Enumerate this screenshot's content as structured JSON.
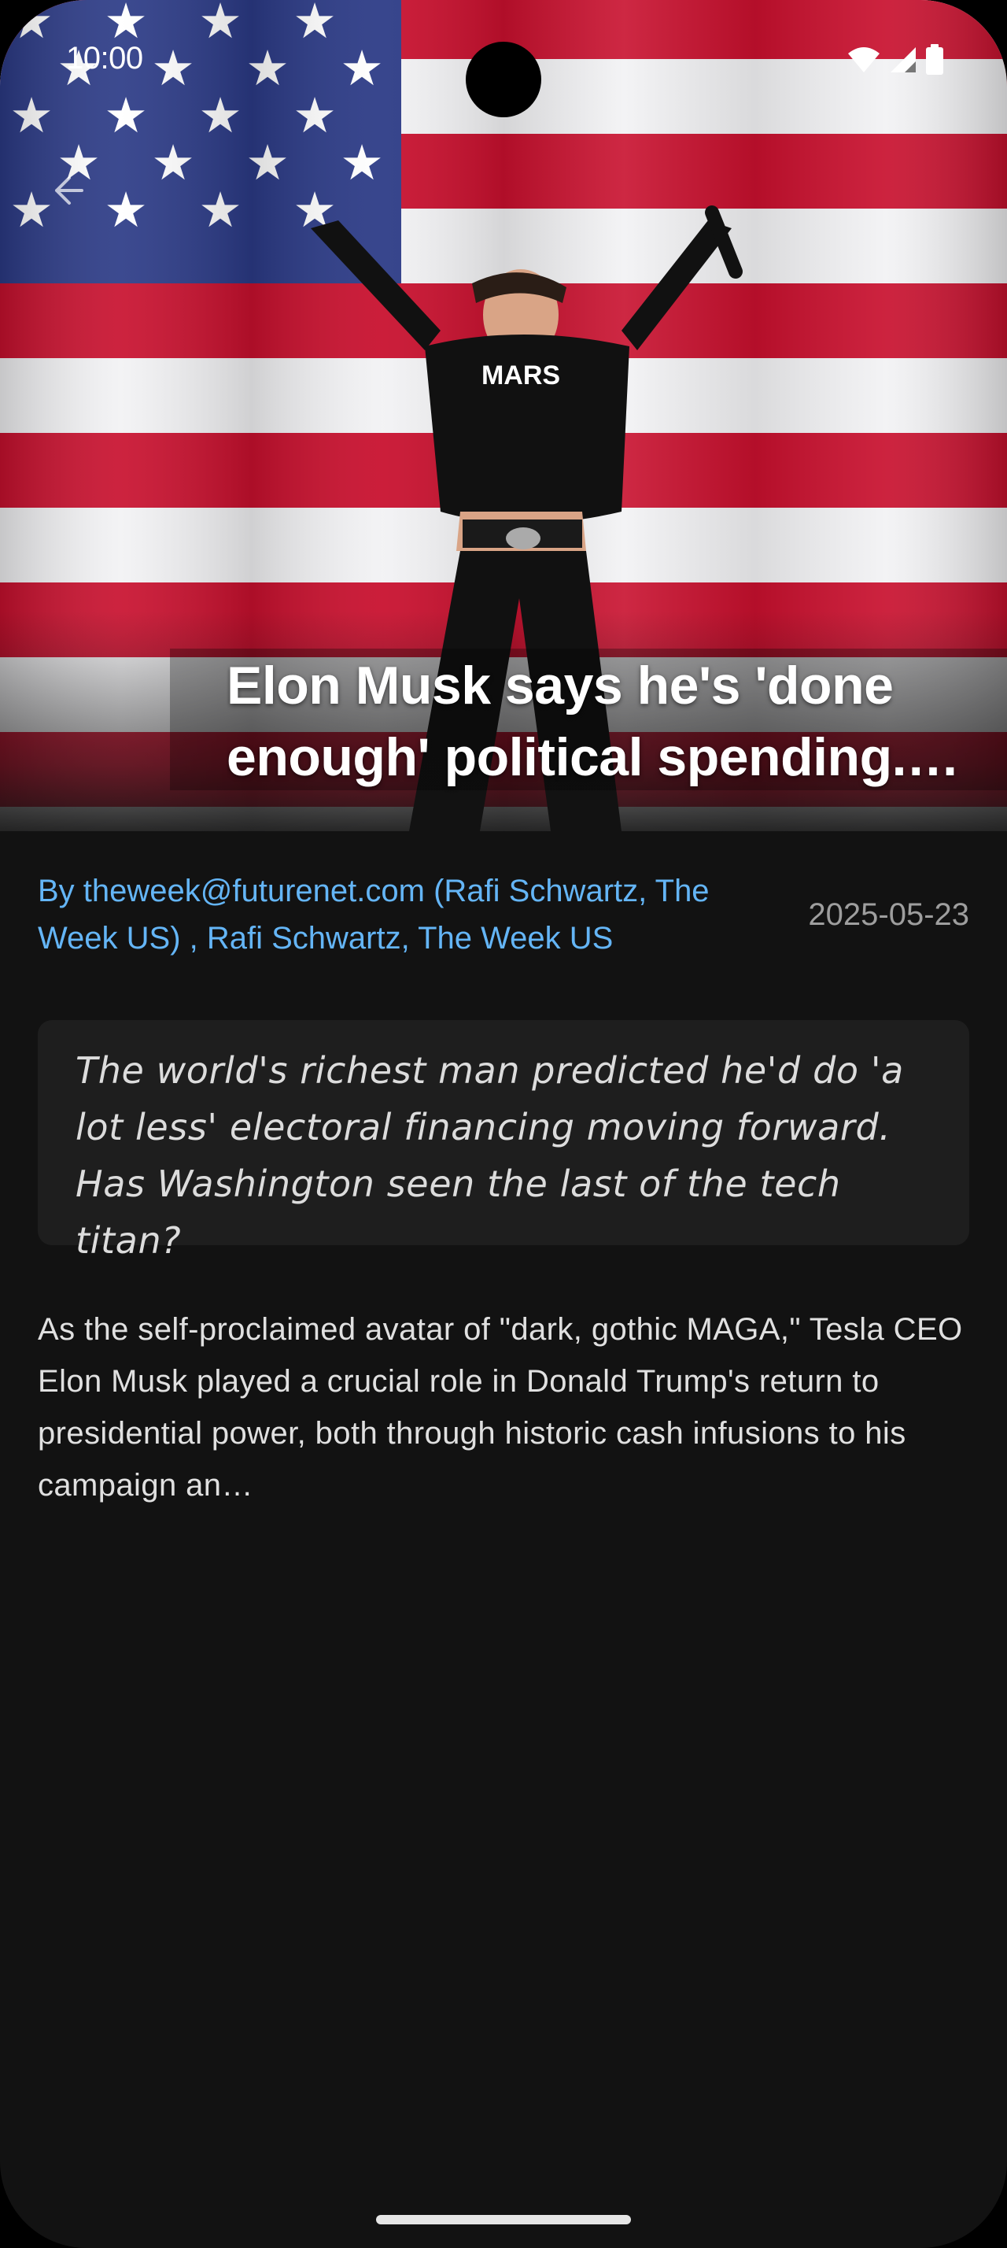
{
  "status_bar": {
    "time": "10:00",
    "icons": [
      "wifi-icon",
      "cellular-signal-icon",
      "battery-icon"
    ]
  },
  "navigation": {
    "back_icon": "arrow-back-icon"
  },
  "article": {
    "title": "Elon Musk says he's 'done enough' political spending. Has Washington seen the last of the tech titan?",
    "hero_image": "photo of Elon Musk jumping in front of an American flag",
    "byline": "By theweek@futurenet.com (Rafi Schwartz, The Week US) , Rafi Schwartz, The Week US",
    "date": "2025-05-23",
    "summary": "The world's richest man predicted he'd do 'a lot less' electoral financing moving forward. Has Washington seen the last of the tech titan?",
    "body": "As the self-proclaimed avatar of \"dark, gothic MAGA,\" Tesla CEO Elon Musk played a crucial role in Donald Trump's return to presidential power, both through historic cash infusions to his campaign an…"
  },
  "colors": {
    "background": "#121212",
    "byline": "#64b5f6",
    "date": "#9e9e9e",
    "summary_card": "#1e1e1e",
    "body_text": "#e0e0e0"
  }
}
